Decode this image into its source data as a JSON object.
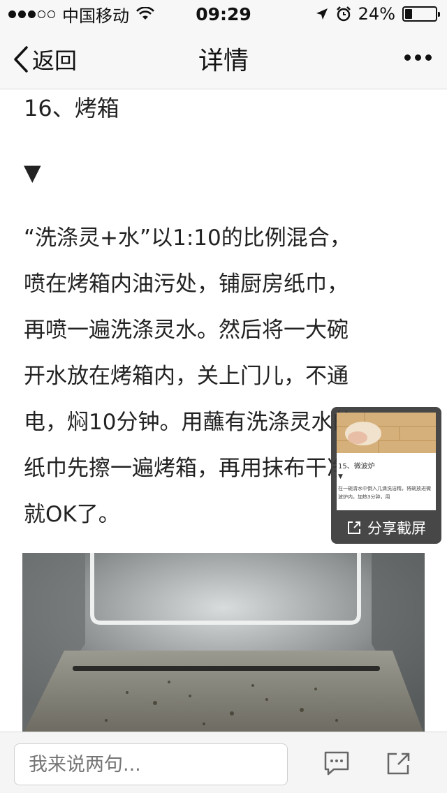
{
  "status_bar": {
    "carrier": "中国移动",
    "time": "09:29",
    "battery_text": "24%",
    "battery_level": 0.24
  },
  "nav": {
    "back_label": "返回",
    "title": "详情"
  },
  "article": {
    "heading": "16、烤箱",
    "arrow": "▼",
    "paragraph_lines": [
      "“洗涤灵+水”以1:10的比例混合，",
      "喷在烤箱内油污处，铺厨房纸巾，",
      "再喷一遍洗涤灵水。然后将一大碗",
      "开水放在烤箱内，关上门儿，不通",
      "电，焖10分钟。用蘸有洗涤灵水的",
      "纸巾先擦一遍烤箱，再用抹布干净",
      "就OK了。"
    ]
  },
  "screenshot_popup": {
    "thumb_heading": "15、微波炉",
    "thumb_arrow": "▼",
    "thumb_text": "在一碗清水中倒入几滴洗洁精，将碗放进微波炉内，加热3分钟，用",
    "share_label": "分享截屏"
  },
  "bottom_bar": {
    "comment_placeholder": "我来说两句..."
  }
}
